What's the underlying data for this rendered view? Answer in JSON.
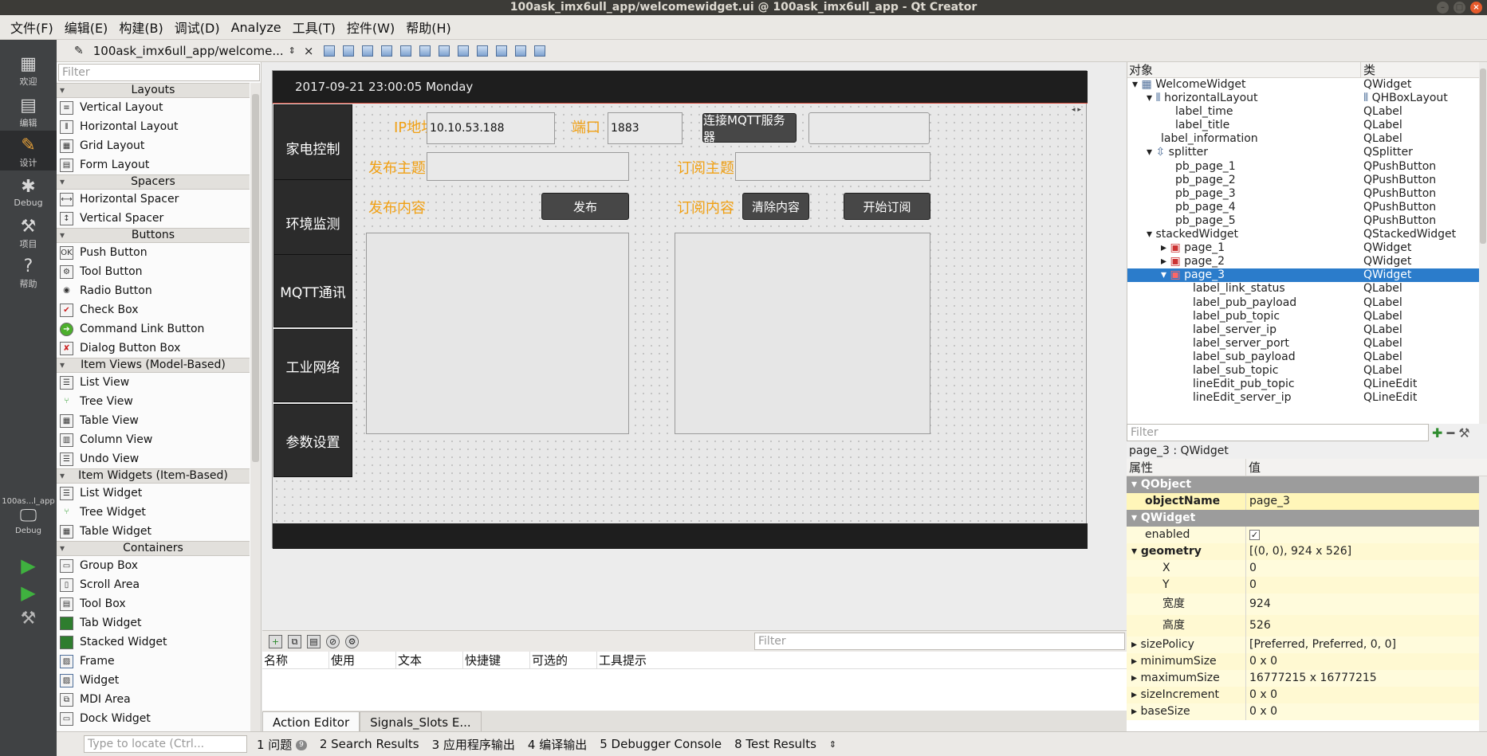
{
  "window": {
    "title": "100ask_imx6ull_app/welcomewidget.ui @ 100ask_imx6ull_app - Qt Creator"
  },
  "menubar": [
    "文件(F)",
    "编辑(E)",
    "构建(B)",
    "调试(D)",
    "Analyze",
    "工具(T)",
    "控件(W)",
    "帮助(H)"
  ],
  "modes": {
    "welcome": "欢迎",
    "edit": "编辑",
    "design": "设计",
    "debug": "Debug",
    "projects": "项目",
    "help": "帮助",
    "kit_name": "100as...l_app",
    "kit_mode": "Debug"
  },
  "editor": {
    "doc_title": "100ask_imx6ull_app/welcome..."
  },
  "widgetbox": {
    "filter_placeholder": "Filter",
    "categories": [
      {
        "name": "Layouts",
        "items": [
          "Vertical Layout",
          "Horizontal Layout",
          "Grid Layout",
          "Form Layout"
        ]
      },
      {
        "name": "Spacers",
        "items": [
          "Horizontal Spacer",
          "Vertical Spacer"
        ]
      },
      {
        "name": "Buttons",
        "items": [
          "Push Button",
          "Tool Button",
          "Radio Button",
          "Check Box",
          "Command Link Button",
          "Dialog Button Box"
        ]
      },
      {
        "name": "Item Views (Model-Based)",
        "items": [
          "List View",
          "Tree View",
          "Table View",
          "Column View",
          "Undo View"
        ]
      },
      {
        "name": "Item Widgets (Item-Based)",
        "items": [
          "List Widget",
          "Tree Widget",
          "Table Widget"
        ]
      },
      {
        "name": "Containers",
        "items": [
          "Group Box",
          "Scroll Area",
          "Tool Box",
          "Tab Widget",
          "Stacked Widget",
          "Frame",
          "Widget",
          "MDI Area",
          "Dock Widget"
        ]
      }
    ]
  },
  "form": {
    "time": "2017-09-21 23:00:05 Monday",
    "nav": [
      "家电控制",
      "环境监测",
      "MQTT通讯",
      "工业网络",
      "参数设置"
    ],
    "ip_label": "IP地址",
    "ip_value": "10.10.53.188",
    "port_label": "端口",
    "port_value": "1883",
    "connect_button": "连接MQTT服务器",
    "pub_topic_label": "发布主题",
    "sub_topic_label": "订阅主题",
    "pub_payload_label": "发布内容",
    "sub_payload_label": "订阅内容",
    "publish_button": "发布",
    "clear_button": "清除内容",
    "subscribe_button": "开始订阅"
  },
  "action_editor": {
    "filter_placeholder": "Filter",
    "columns": [
      "名称",
      "使用",
      "文本",
      "快捷键",
      "可选的",
      "工具提示"
    ],
    "tabs": [
      "Action Editor",
      "Signals_Slots E..."
    ]
  },
  "object_inspector": {
    "col_object": "对象",
    "col_class": "类",
    "rows": [
      {
        "name": "WelcomeWidget",
        "cls": "QWidget"
      },
      {
        "name": "horizontalLayout",
        "cls": "QHBoxLayout"
      },
      {
        "name": "label_time",
        "cls": "QLabel"
      },
      {
        "name": "label_title",
        "cls": "QLabel"
      },
      {
        "name": "label_information",
        "cls": "QLabel"
      },
      {
        "name": "splitter",
        "cls": "QSplitter"
      },
      {
        "name": "pb_page_1",
        "cls": "QPushButton"
      },
      {
        "name": "pb_page_2",
        "cls": "QPushButton"
      },
      {
        "name": "pb_page_3",
        "cls": "QPushButton"
      },
      {
        "name": "pb_page_4",
        "cls": "QPushButton"
      },
      {
        "name": "pb_page_5",
        "cls": "QPushButton"
      },
      {
        "name": "stackedWidget",
        "cls": "QStackedWidget"
      },
      {
        "name": "page_1",
        "cls": "QWidget"
      },
      {
        "name": "page_2",
        "cls": "QWidget"
      },
      {
        "name": "page_3",
        "cls": "QWidget"
      },
      {
        "name": "label_link_status",
        "cls": "QLabel"
      },
      {
        "name": "label_pub_payload",
        "cls": "QLabel"
      },
      {
        "name": "label_pub_topic",
        "cls": "QLabel"
      },
      {
        "name": "label_server_ip",
        "cls": "QLabel"
      },
      {
        "name": "label_server_port",
        "cls": "QLabel"
      },
      {
        "name": "label_sub_payload",
        "cls": "QLabel"
      },
      {
        "name": "label_sub_topic",
        "cls": "QLabel"
      },
      {
        "name": "lineEdit_pub_topic",
        "cls": "QLineEdit"
      },
      {
        "name": "lineEdit_server_ip",
        "cls": "QLineEdit"
      }
    ],
    "filter_placeholder": "Filter"
  },
  "property_editor": {
    "caption": "page_3 : QWidget",
    "col_property": "属性",
    "col_value": "值",
    "qobject": "QObject",
    "objectName_key": "objectName",
    "objectName_val": "page_3",
    "qwidget": "QWidget",
    "enabled_key": "enabled",
    "enabled_val": "✓",
    "geometry_key": "geometry",
    "geometry_val": "[(0, 0), 924 x 526]",
    "x_key": "X",
    "x_val": "0",
    "y_key": "Y",
    "y_val": "0",
    "w_key": "宽度",
    "w_val": "924",
    "h_key": "高度",
    "h_val": "526",
    "sizePolicy_key": "sizePolicy",
    "sizePolicy_val": "[Preferred, Preferred, 0, 0]",
    "minimumSize_key": "minimumSize",
    "minimumSize_val": "0 x 0",
    "maximumSize_key": "maximumSize",
    "maximumSize_val": "16777215 x 16777215",
    "sizeIncrement_key": "sizeIncrement",
    "sizeIncrement_val": "0 x 0",
    "baseSize_key": "baseSize",
    "baseSize_val": "0 x 0"
  },
  "statusbar": {
    "locate_placeholder": "Type to locate (Ctrl...",
    "items": [
      "1 问题",
      "2 Search Results",
      "3 应用程序输出",
      "4 编译输出",
      "5 Debugger Console",
      "8 Test Results"
    ],
    "problems_count": "9"
  }
}
